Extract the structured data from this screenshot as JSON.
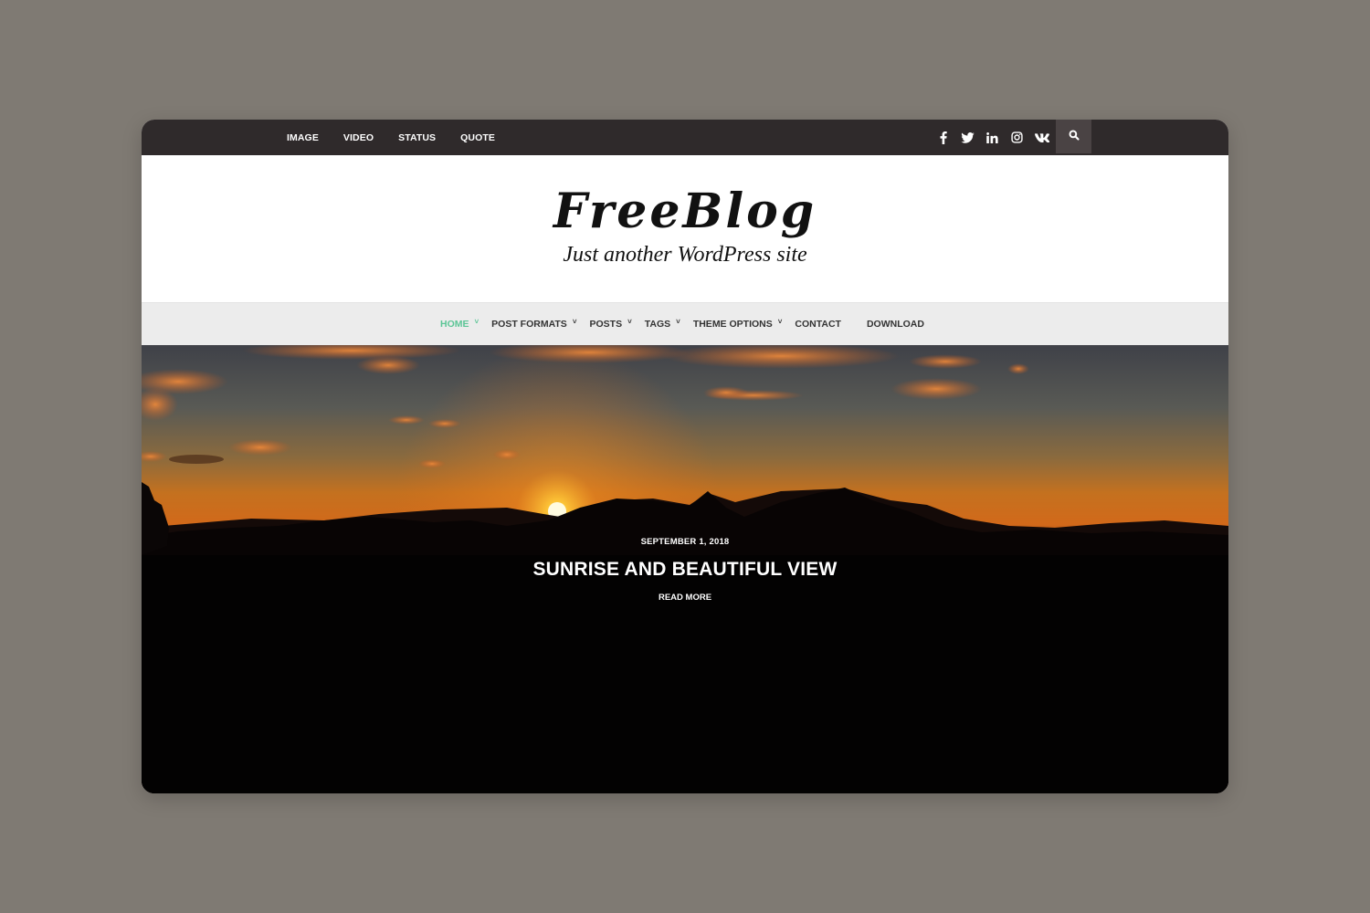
{
  "colors": {
    "page_background": "#7f7a73",
    "topbar": "#2f2a2b",
    "search_button": "#4a4344",
    "nav_background": "#ececec",
    "nav_active": "#5cc596",
    "nav_text": "#333333"
  },
  "topbar": {
    "menu": [
      {
        "label": "IMAGE"
      },
      {
        "label": "VIDEO"
      },
      {
        "label": "STATUS"
      },
      {
        "label": "QUOTE"
      }
    ],
    "social_icons": [
      "facebook-icon",
      "twitter-icon",
      "linkedin-icon",
      "instagram-icon",
      "vk-icon"
    ],
    "search_icon": "search-icon"
  },
  "header": {
    "site_title": "FreeBlog",
    "tagline": "Just another WordPress site"
  },
  "nav": {
    "items": [
      {
        "label": "HOME",
        "has_dropdown": true,
        "active": true
      },
      {
        "label": "POST FORMATS",
        "has_dropdown": true
      },
      {
        "label": "POSTS",
        "has_dropdown": true
      },
      {
        "label": "TAGS",
        "has_dropdown": true
      },
      {
        "label": "THEME OPTIONS",
        "has_dropdown": true
      },
      {
        "label": "CONTACT",
        "has_dropdown": false
      },
      {
        "label": "DOWNLOAD",
        "has_dropdown": false
      }
    ],
    "chevron": "˅"
  },
  "hero": {
    "date": "SEPTEMBER 1, 2018",
    "title": "SUNRISE AND BEAUTIFUL VIEW",
    "read_more": "READ MORE"
  }
}
